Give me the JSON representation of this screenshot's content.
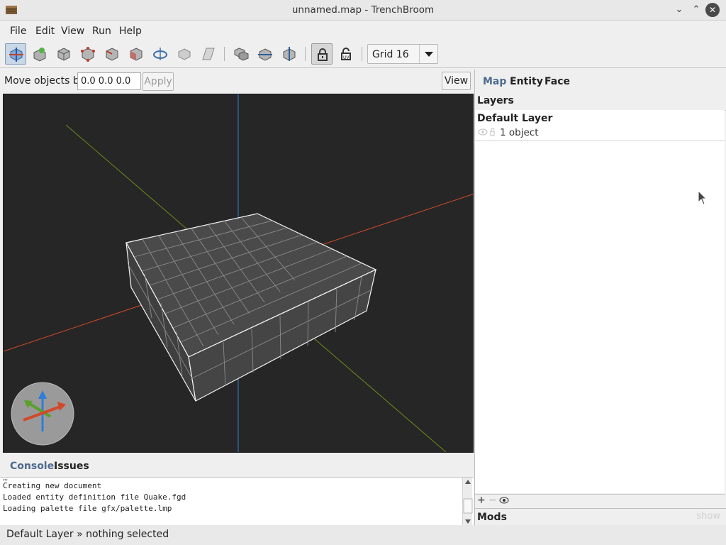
{
  "window": {
    "title": "unnamed.map - TrenchBroom"
  },
  "menu": [
    "File",
    "Edit",
    "View",
    "Run",
    "Help"
  ],
  "toolbar": {
    "tools": [
      "select-tool-icon",
      "entity-tool-icon",
      "brush-tool-icon",
      "vertex-tool-icon",
      "edge-tool-icon",
      "face-tool-icon",
      "rotate-tool-icon",
      "scale-tool-icon",
      "shear-tool-icon",
      "duplicate-icon",
      "flip-horizontal-icon",
      "flip-vertical-icon",
      "texture-lock-icon",
      "uv-lock-icon"
    ],
    "grid_value": "Grid 16"
  },
  "move": {
    "label": "Move objects by",
    "value": "0.0 0.0 0.0",
    "apply_label": "Apply",
    "view_label": "View"
  },
  "console": {
    "tabs": [
      "Console",
      "Issues"
    ],
    "lines": [
      "Creating new document",
      "Loaded entity definition file Quake.fgd",
      "Loading palette file gfx/palette.lmp"
    ]
  },
  "status": {
    "text": "Default Layer » nothing selected"
  },
  "inspector": {
    "tabs": [
      "Map",
      "Entity",
      "Face"
    ],
    "layers_title": "Layers",
    "layer": {
      "name": "Default Layer",
      "count": "1 object"
    },
    "mods_title": "Mods",
    "mods_action": "show"
  },
  "colors": {
    "accent": "#4d6a8f",
    "viewport_bg": "#262626",
    "x_axis": "#d2492a",
    "y_axis": "#6c8a1e",
    "z_axis": "#2d7dd8"
  }
}
